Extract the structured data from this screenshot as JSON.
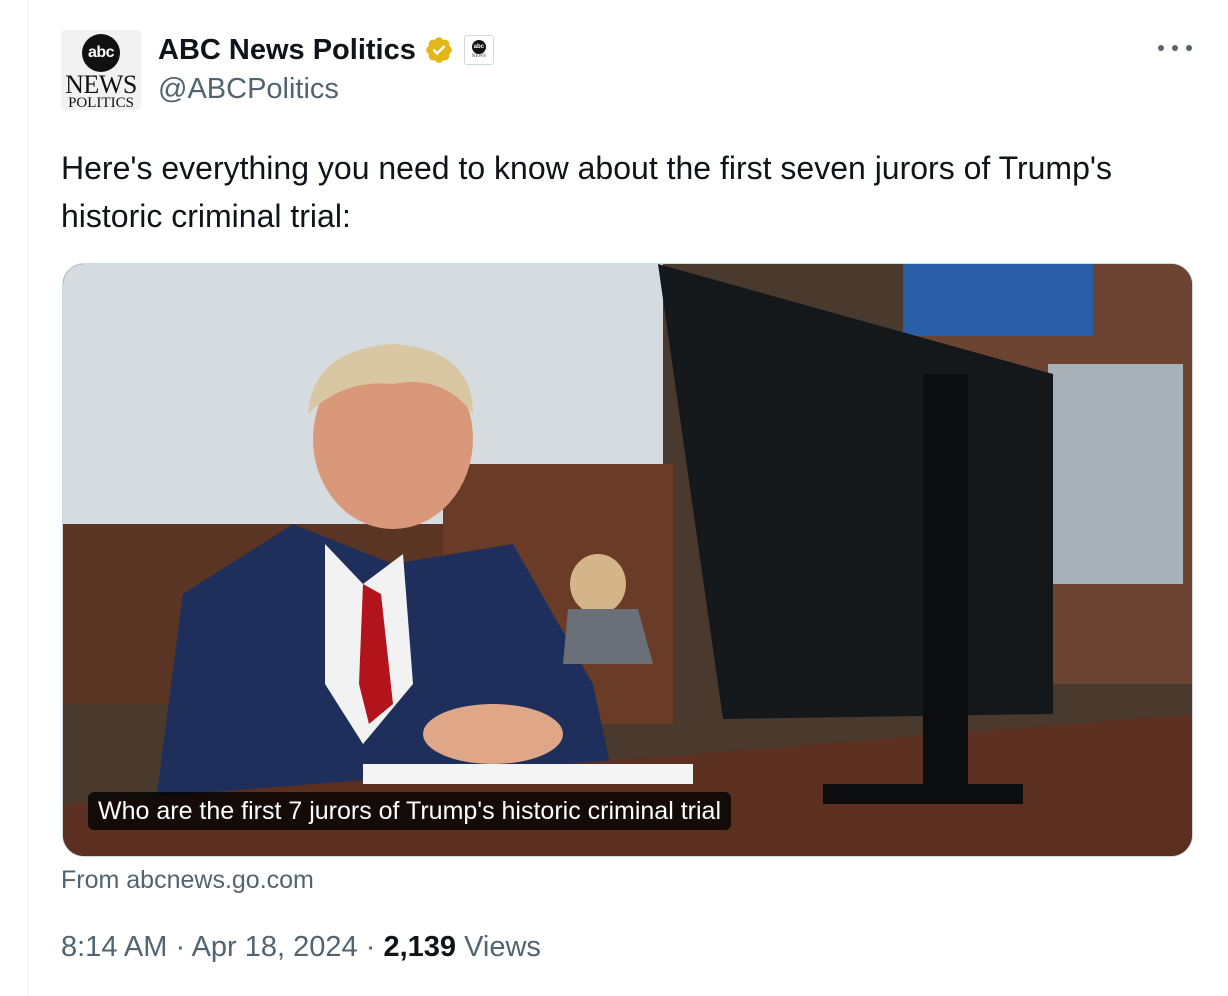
{
  "account": {
    "display_name": "ABC News Politics",
    "handle": "@ABCPolitics",
    "avatar_logo": {
      "abc": "abc",
      "news": "NEWS",
      "politics": "POLITICS"
    },
    "verified_icon": "gold-verified-badge-icon",
    "affiliation_logo": {
      "abc": "abc",
      "news": "NEWS"
    }
  },
  "more_icon": "more-options-icon",
  "tweet": {
    "text": "Here's everything you need to know about the first seven jurors of Trump's historic criminal trial:"
  },
  "card": {
    "caption": "Who are the first 7 jurors of Trump's historic criminal trial",
    "source": "From abcnews.go.com"
  },
  "meta": {
    "time": "8:14 AM",
    "separator1": " · ",
    "date": "Apr 18, 2024",
    "separator2": " · ",
    "views_count": "2,139",
    "views_label": " Views"
  },
  "colors": {
    "text_primary": "#0f1419",
    "text_secondary": "#536471",
    "border": "#cfd9de",
    "verified_gold": "#e2b719"
  }
}
